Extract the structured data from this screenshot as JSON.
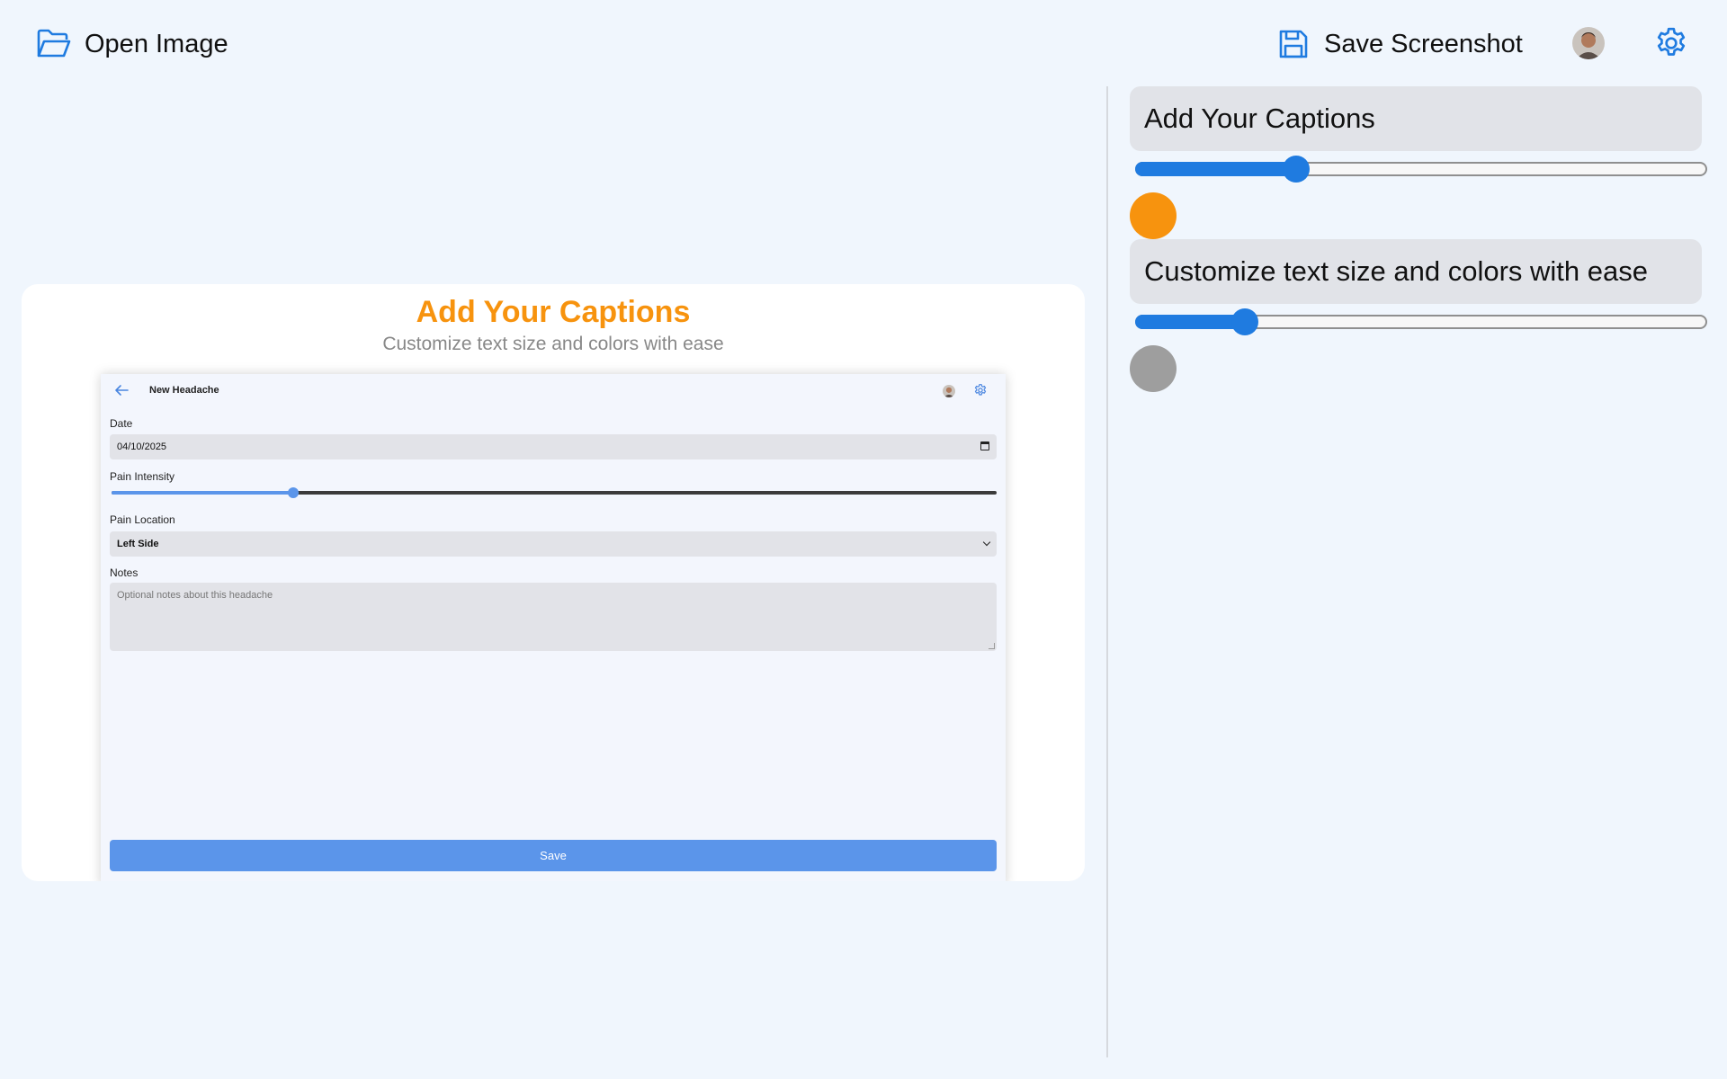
{
  "toolbar": {
    "open_label": "Open Image",
    "save_label": "Save Screenshot"
  },
  "preview": {
    "caption_title": "Add Your Captions",
    "caption_subtitle": "Customize text size and colors with ease",
    "screen": {
      "title": "New Headache",
      "date_label": "Date",
      "date_value": "04/10/2025",
      "intensity_label": "Pain Intensity",
      "intensity_fraction": 0.205,
      "location_label": "Pain Location",
      "location_value": "Left Side",
      "notes_label": "Notes",
      "notes_placeholder": "Optional notes about this headache",
      "save_label": "Save"
    }
  },
  "editor": {
    "captions": [
      {
        "text": "Add Your Captions",
        "size_fraction": 0.28,
        "color": "#f7930e"
      },
      {
        "text": "Customize text size and colors with ease",
        "size_fraction": 0.19,
        "color": "#9e9e9e"
      }
    ]
  },
  "colors": {
    "accent": "#1f7be0",
    "caption_title": "#f7930e",
    "caption_subtitle": "#888888",
    "mock_accent": "#5b95ea"
  },
  "icons": {
    "open": "folder-open-icon",
    "save": "floppy-disk-icon",
    "settings": "gear-icon",
    "back": "arrow-left-icon"
  }
}
